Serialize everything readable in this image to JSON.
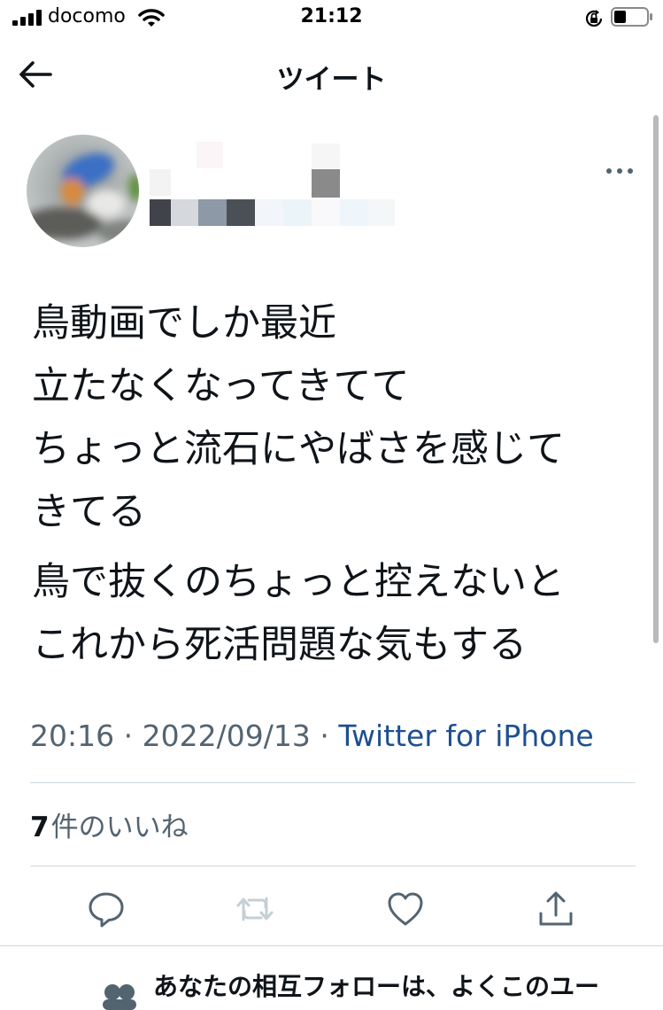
{
  "status_bar": {
    "carrier": "docomo",
    "time": "21:12"
  },
  "nav": {
    "title": "ツイート"
  },
  "tweet": {
    "paragraphs": [
      "鳥動画でしか最近\n立たなくなってきてて\nちょっと流石にやばさを感じて\nきてる",
      "鳥で抜くのちょっと控えないと\nこれから死活問題な気もする"
    ],
    "time": "20:16",
    "date": "2022/09/13",
    "separator": "·",
    "source": "Twitter for iPhone"
  },
  "likes": {
    "count": "7",
    "label": "件のいいね"
  },
  "actions": [
    "reply-icon",
    "retweet-icon",
    "like-icon",
    "share-icon"
  ],
  "notice": {
    "text": "あなたの相互フォローは、よくこのユー"
  },
  "colors": {
    "text": "#0f1419",
    "secondary": "#536471",
    "link": "#1d4f91",
    "divider": "#cfd9de"
  }
}
